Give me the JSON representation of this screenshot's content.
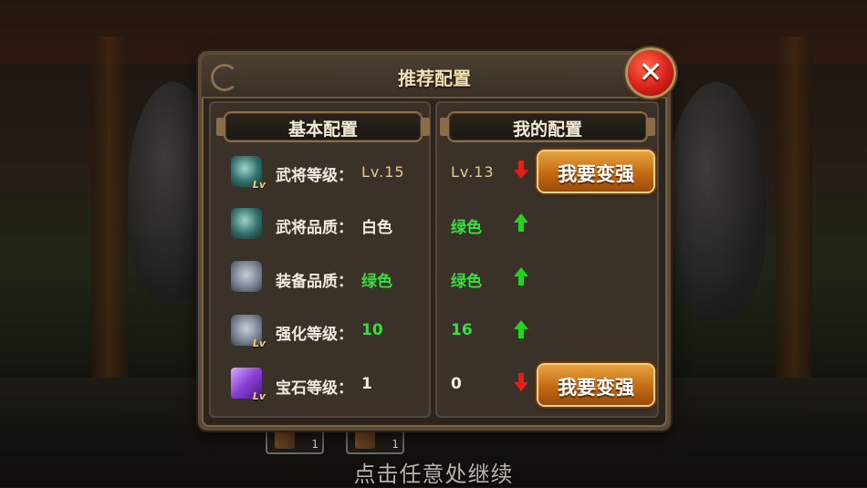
{
  "dialog": {
    "title": "推荐配置",
    "close_symbol": "✕"
  },
  "columns": {
    "basic": "基本配置",
    "mine": "我的配置"
  },
  "rows": [
    {
      "icon": "hero-level-icon",
      "label": "武将等级：",
      "recommended": "Lv.15",
      "mine": "Lv.13",
      "trend": "down",
      "action": "我要变强"
    },
    {
      "icon": "hero-quality-icon",
      "label": "武将品质：",
      "recommended": "白色",
      "mine": "绿色",
      "trend": "up",
      "action": ""
    },
    {
      "icon": "equipment-quality-icon",
      "label": "装备品质：",
      "recommended": "绿色",
      "mine": "绿色",
      "trend": "up",
      "action": ""
    },
    {
      "icon": "enhance-level-icon",
      "label": "强化等级：",
      "recommended": "10",
      "mine": "16",
      "trend": "up",
      "action": ""
    },
    {
      "icon": "gem-level-icon",
      "label": "宝石等级：",
      "recommended": "1",
      "mine": "0",
      "trend": "down",
      "action": "我要变强"
    }
  ],
  "icon_badge": "Lv",
  "bottom_slots": [
    {
      "count": "1"
    },
    {
      "count": "1"
    }
  ],
  "continue_hint": "点击任意处继续",
  "colors": {
    "green": "#33e23a",
    "up_arrow": "#20d51c",
    "down_arrow": "#e0211a",
    "button_orange": "#c46a13"
  }
}
